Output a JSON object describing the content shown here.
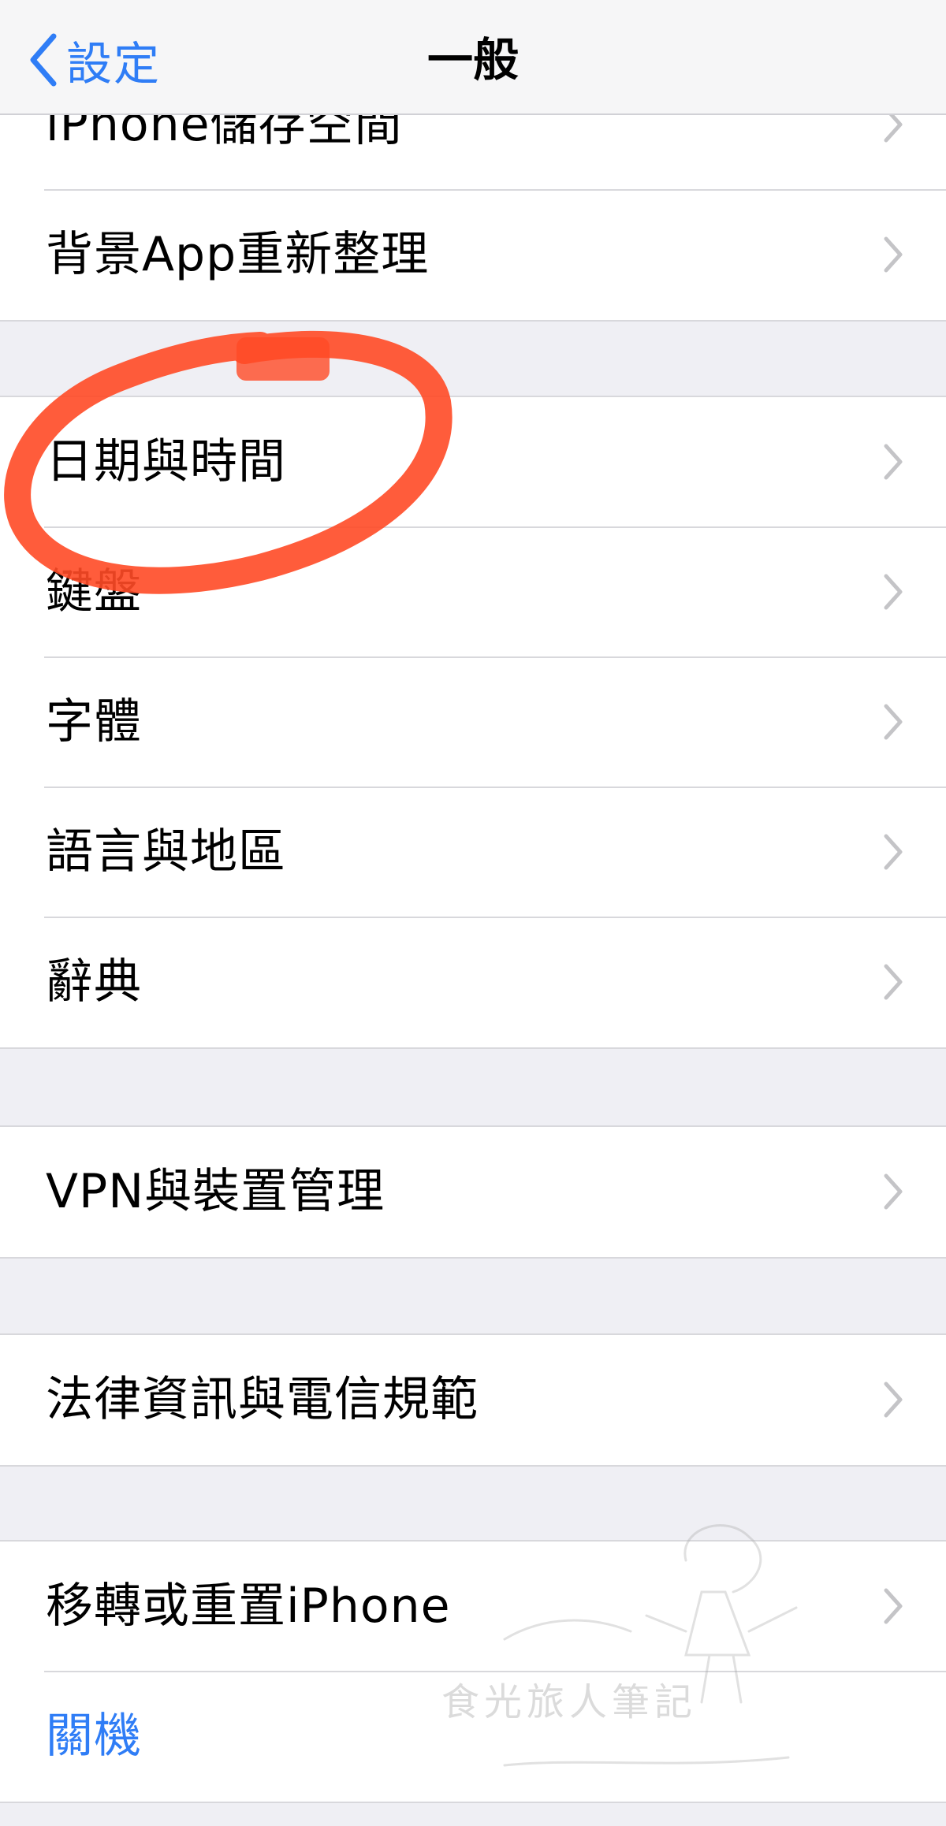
{
  "nav": {
    "back_label": "設定",
    "title": "一般"
  },
  "groups": {
    "top": {
      "items": [
        {
          "label": "iPhone儲存空間"
        },
        {
          "label": "背景App重新整理"
        }
      ]
    },
    "datetime": {
      "items": [
        {
          "label": "日期與時間"
        },
        {
          "label": "鍵盤"
        },
        {
          "label": "字體"
        },
        {
          "label": "語言與地區"
        },
        {
          "label": "辭典"
        }
      ]
    },
    "vpn": {
      "items": [
        {
          "label": "VPN與裝置管理"
        }
      ]
    },
    "legal": {
      "items": [
        {
          "label": "法律資訊與電信規範"
        }
      ]
    },
    "reset": {
      "items": [
        {
          "label": "移轉或重置iPhone"
        },
        {
          "label": "關機"
        }
      ]
    }
  },
  "watermark": {
    "text": "食光旅人筆記"
  },
  "colors": {
    "accent": "#2f7df6",
    "annotation": "#ff4a26",
    "background": "#efeff4"
  },
  "icons": {
    "back": "chevron-left-icon",
    "disclosure": "chevron-right-icon"
  }
}
